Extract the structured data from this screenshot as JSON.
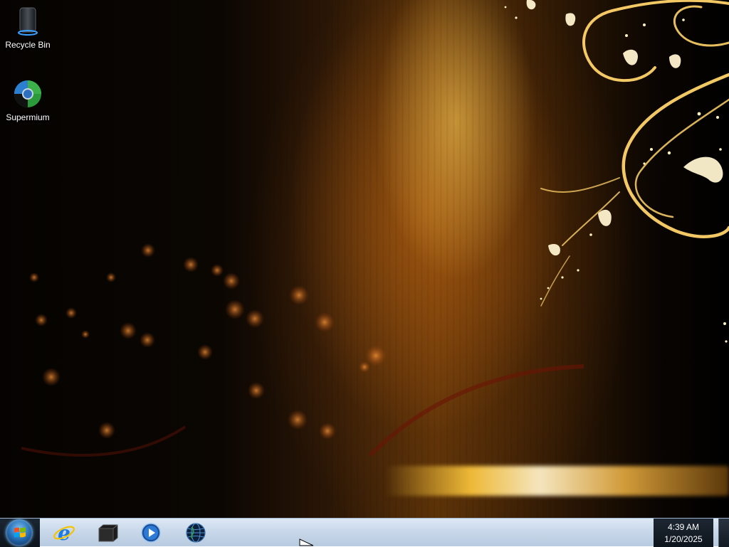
{
  "desktop": {
    "icons": [
      {
        "label": "Recycle Bin",
        "icon": "recycle-bin-icon"
      },
      {
        "label": "Supermium",
        "icon": "supermium-browser-icon"
      }
    ]
  },
  "taskbar": {
    "start_button": "windows-start-orb-icon",
    "pinned": [
      {
        "icon": "internet-explorer-icon"
      },
      {
        "icon": "file-explorer-icon"
      },
      {
        "icon": "media-player-icon"
      },
      {
        "icon": "globe-network-icon"
      }
    ],
    "clock": {
      "time": "4:39 AM",
      "date": "1/20/2025"
    }
  },
  "colors": {
    "accent_gold": "#ffcc55",
    "taskbar_light": "#c9d8ea",
    "tray_dark": "#0e151d"
  }
}
